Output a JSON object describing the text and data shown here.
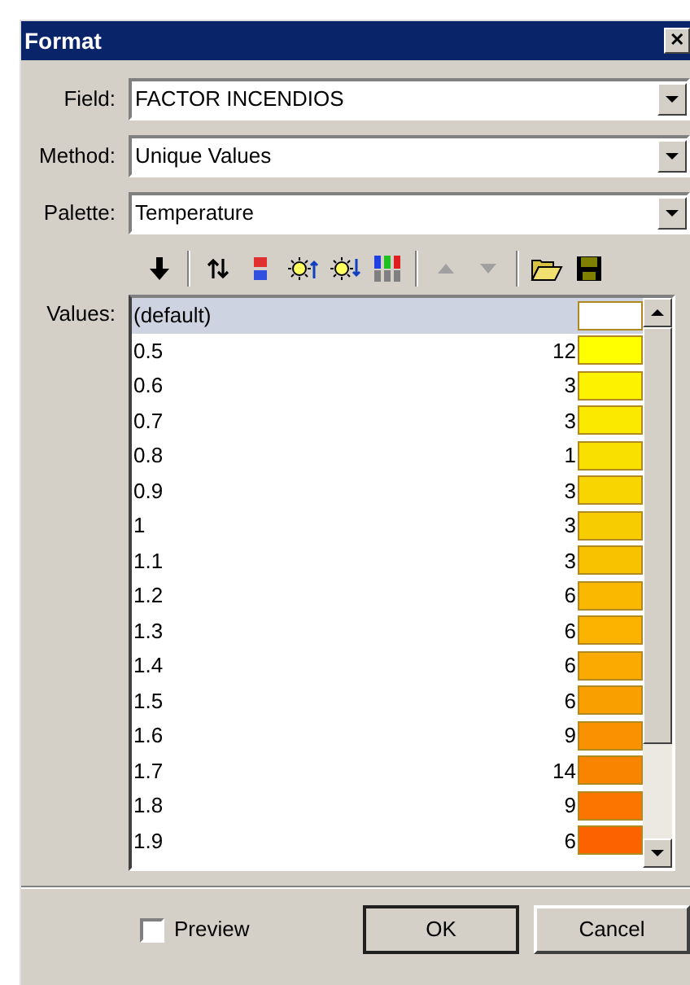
{
  "window": {
    "title": "Format",
    "close": "✕"
  },
  "fields": [
    {
      "label": "Field:",
      "value": "FACTOR INCENDIOS"
    },
    {
      "label": "Method:",
      "value": "Unique Values"
    },
    {
      "label": "Palette:",
      "value": "Temperature"
    }
  ],
  "toolbar": [
    {
      "kind": "down"
    },
    {
      "kind": "sep"
    },
    {
      "kind": "swap"
    },
    {
      "kind": "palette"
    },
    {
      "kind": "brighter"
    },
    {
      "kind": "darker"
    },
    {
      "kind": "bars"
    },
    {
      "kind": "sep"
    },
    {
      "kind": "up",
      "disabled": true
    },
    {
      "kind": "down-tri",
      "disabled": true
    },
    {
      "kind": "sep"
    },
    {
      "kind": "open"
    },
    {
      "kind": "save"
    }
  ],
  "values_label": "Values:",
  "values": [
    {
      "value": "(default)",
      "color": "#ffffff",
      "selected": true
    },
    {
      "value": "0.5",
      "count": "12",
      "color": "#ffff00",
      "selected": false
    },
    {
      "value": "0.6",
      "count": "3",
      "color": "#fdf200",
      "selected": false
    },
    {
      "value": "0.7",
      "count": "3",
      "color": "#fbea00",
      "selected": false
    },
    {
      "value": "0.8",
      "count": "1",
      "color": "#f9e000",
      "selected": false
    },
    {
      "value": "0.9",
      "count": "3",
      "color": "#f8d500",
      "selected": false
    },
    {
      "value": "1",
      "count": "3",
      "color": "#f7cc00",
      "selected": false
    },
    {
      "value": "1.1",
      "count": "3",
      "color": "#f8c200",
      "selected": false
    },
    {
      "value": "1.2",
      "count": "6",
      "color": "#fbb800",
      "selected": false
    },
    {
      "value": "1.3",
      "count": "6",
      "color": "#fbb300",
      "selected": false
    },
    {
      "value": "1.4",
      "count": "6",
      "color": "#faaa00",
      "selected": false
    },
    {
      "value": "1.5",
      "count": "6",
      "color": "#fa9f00",
      "selected": false
    },
    {
      "value": "1.6",
      "count": "9",
      "color": "#f99100",
      "selected": false
    },
    {
      "value": "1.7",
      "count": "14",
      "color": "#f98400",
      "selected": false
    },
    {
      "value": "1.8",
      "count": "9",
      "color": "#fb7500",
      "selected": false
    },
    {
      "value": "1.9",
      "count": "6",
      "color": "#fc6200",
      "selected": false
    }
  ],
  "preview": {
    "label": "Preview",
    "checked": false
  },
  "buttons": [
    "OK",
    "Cancel"
  ]
}
